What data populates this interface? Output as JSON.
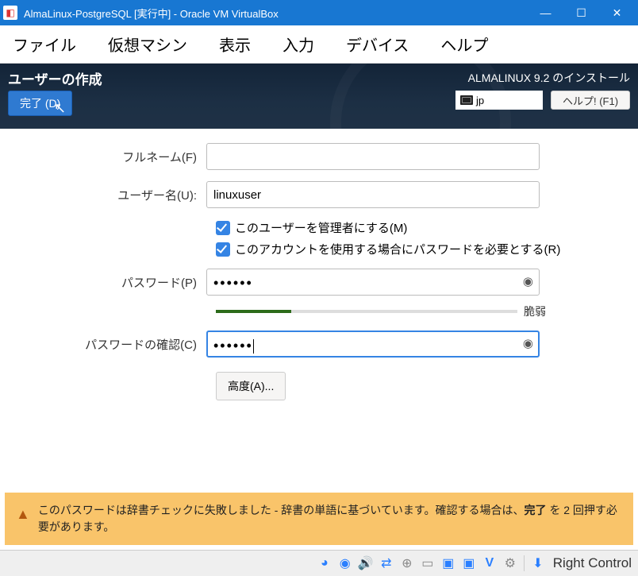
{
  "window": {
    "title": "AlmaLinux-PostgreSQL [実行中] - Oracle VM VirtualBox"
  },
  "menu": {
    "file": "ファイル",
    "machine": "仮想マシン",
    "view": "表示",
    "input": "入力",
    "devices": "デバイス",
    "help": "ヘルプ"
  },
  "installer": {
    "page_title": "ユーザーの作成",
    "done_btn": "完了 (D)",
    "product_label": "ALMALINUX 9.2 のインストール",
    "keyboard_layout": "jp",
    "help_btn": "ヘルプ! (F1)"
  },
  "form": {
    "fullname_label": "フルネーム(F)",
    "fullname_value": "",
    "username_label": "ユーザー名(U):",
    "username_value": "linuxuser",
    "admin_checkbox": "このユーザーを管理者にする(M)",
    "requirepw_checkbox": "このアカウントを使用する場合にパスワードを必要とする(R)",
    "password_label": "パスワード(P)",
    "password_value": "••••••",
    "strength_text": "脆弱",
    "strength_percent": 25,
    "confirm_label": "パスワードの確認(C)",
    "confirm_value": "••••••",
    "advanced_btn": "高度(A)..."
  },
  "warning": {
    "text_pre": "このパスワードは辞書チェックに失敗しました - 辞書の単語に基づいています。確認する場合は、",
    "text_bold": "完了",
    "text_post": " を 2 回押す必要があります。"
  },
  "statusbar": {
    "host_key": "Right Control"
  }
}
